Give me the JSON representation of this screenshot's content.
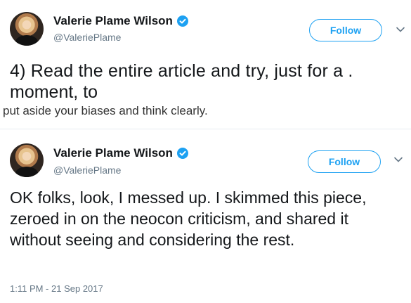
{
  "tweets": [
    {
      "name": "Valerie Plame Wilson",
      "handle": "@ValeriePlame",
      "follow_label": "Follow",
      "lines": [
        "4)  Read the entire article and try, just for a .",
        "moment, to",
        "put aside your biases and think clearly."
      ]
    },
    {
      "name": "Valerie Plame Wilson",
      "handle": "@ValeriePlame",
      "follow_label": "Follow",
      "text": "OK folks, look, I messed up. I skimmed this piece, zeroed in on the neocon criticism, and shared it without seeing and considering the rest.",
      "timestamp": "1:11 PM - 21 Sep 2017"
    }
  ],
  "icons": {
    "verified": "verified-badge-icon",
    "chevron": "chevron-down-icon"
  },
  "colors": {
    "accent": "#1da1f2",
    "secondary_text": "#657786"
  }
}
